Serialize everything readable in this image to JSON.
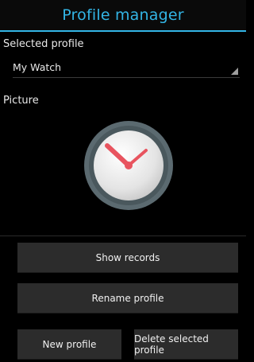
{
  "header": {
    "title": "Profile manager"
  },
  "profile": {
    "selected_label": "Selected profile",
    "selected_value": "My Watch",
    "picture_label": "Picture",
    "picture_icon": "clock-icon"
  },
  "actions": {
    "show_records": "Show records",
    "rename_profile": "Rename profile",
    "new_profile": "New profile",
    "delete_profile": "Delete selected profile"
  },
  "colors": {
    "accent": "#33b5e5",
    "background": "#000000",
    "button": "#2c2c2c",
    "clock_hands": "#e8545f"
  }
}
